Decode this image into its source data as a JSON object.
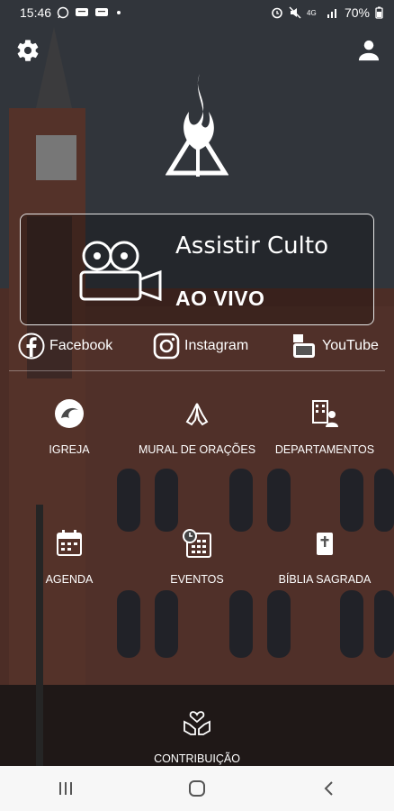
{
  "status_bar": {
    "time": "15:46",
    "battery": "70%",
    "left_icons": [
      "whatsapp-icon",
      "message-icon",
      "message-icon",
      "dot-icon"
    ],
    "right_icons": [
      "alarm-icon",
      "mute-icon",
      "lte-icon",
      "signal-icon",
      "battery-icon"
    ]
  },
  "header": {
    "settings_icon": "gear-icon",
    "profile_icon": "user-icon",
    "logo_icon": "church-logo-icon"
  },
  "live": {
    "title": "Assistir Culto",
    "subtitle": "AO VIVO",
    "icon": "film-projector-icon"
  },
  "social": [
    {
      "label": "Facebook",
      "icon": "facebook-icon"
    },
    {
      "label": "Instagram",
      "icon": "instagram-icon"
    },
    {
      "label": "YouTube",
      "icon": "youtube-icon"
    }
  ],
  "menu": [
    {
      "label": "IGREJA",
      "icon": "church-emblem-icon"
    },
    {
      "label": "MURAL DE ORAÇÕES",
      "icon": "praying-hands-icon"
    },
    {
      "label": "DEPARTAMENTOS",
      "icon": "departments-icon"
    },
    {
      "label": "AGENDA",
      "icon": "calendar-icon"
    },
    {
      "label": "EVENTOS",
      "icon": "event-calendar-icon"
    },
    {
      "label": "BÍBLIA SAGRADA",
      "icon": "bible-icon"
    },
    {
      "label": "CONTRIBUIÇÃO",
      "icon": "giving-hands-icon"
    }
  ],
  "nav_bar": {
    "recent_icon": "recent-apps-icon",
    "home_icon": "home-icon",
    "back_icon": "back-icon"
  },
  "colors": {
    "nav_background": "#f7f7f7",
    "text": "#ffffff"
  }
}
